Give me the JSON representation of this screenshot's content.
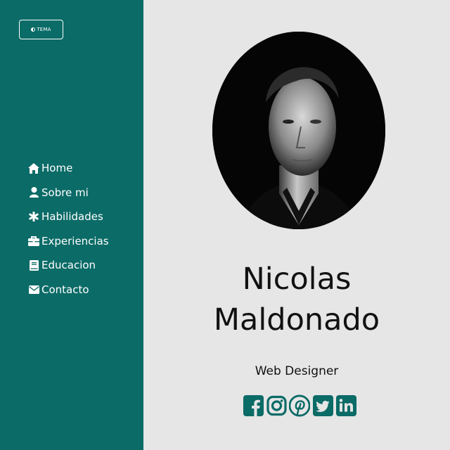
{
  "theme_button": {
    "label": "TEMA",
    "icon": "half-circle-icon"
  },
  "nav": {
    "items": [
      {
        "label": "Home",
        "icon": "home-icon"
      },
      {
        "label": "Sobre mi",
        "icon": "user-icon"
      },
      {
        "label": "Habilidades",
        "icon": "asterisk-icon"
      },
      {
        "label": "Experiencias",
        "icon": "briefcase-icon"
      },
      {
        "label": "Educacion",
        "icon": "book-icon"
      },
      {
        "label": "Contacto",
        "icon": "envelope-icon"
      }
    ]
  },
  "profile": {
    "first_name": "Nicolas",
    "last_name": "Maldonado",
    "role": "Web Designer"
  },
  "social": [
    "facebook-icon",
    "instagram-icon",
    "pinterest-icon",
    "twitter-icon",
    "linkedin-icon"
  ],
  "colors": {
    "sidebar": "#0b6b67",
    "background": "#e6e6e6",
    "accent": "#0b6b67"
  }
}
